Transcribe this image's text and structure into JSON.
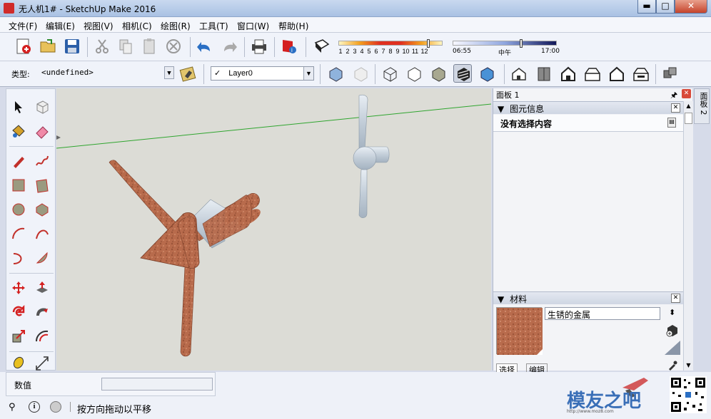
{
  "window": {
    "title": "无人机1# - SketchUp Make 2016",
    "minimize": "▬",
    "maximize": "□",
    "close": "✕"
  },
  "menu": [
    "文件(F)",
    "编辑(E)",
    "视图(V)",
    "相机(C)",
    "绘图(R)",
    "工具(T)",
    "窗口(W)",
    "帮助(H)"
  ],
  "shadow": {
    "months": [
      "1",
      "2",
      "3",
      "4",
      "5",
      "6",
      "7",
      "8",
      "9",
      "10",
      "11",
      "12"
    ],
    "time_start": "06:55",
    "time_mid": "中午",
    "time_end": "17:00"
  },
  "entity_type_label": "类型:",
  "entity_type_value": "<undefined>",
  "layer_check": "✓",
  "layer_value": "Layer0",
  "panel": {
    "tray_title": "面板 1",
    "tray_tab": "面板 2",
    "entity_info_header": "图元信息",
    "no_selection": "没有选择内容",
    "materials_header": "材料",
    "material_name": "生锈的金属",
    "select_tab": "选择",
    "edit_tab": "编辑"
  },
  "status": {
    "measure_label": "数值",
    "hint": "按方向拖动以平移"
  },
  "watermark": {
    "name": "模友之吧",
    "url": "http://www.moz8.com"
  },
  "colors": {
    "rust": "#b4664a",
    "metal": "#c8d2dc",
    "axis_green": "#2fa52f",
    "sky": "#dcdcd6"
  }
}
